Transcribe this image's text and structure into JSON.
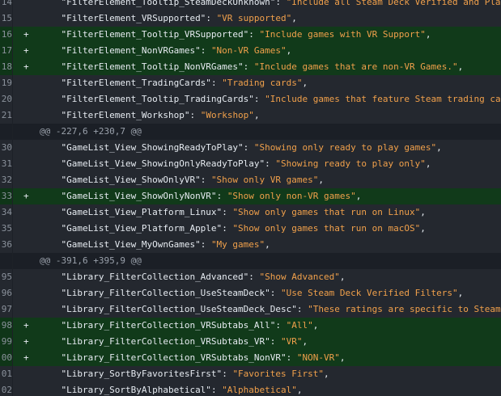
{
  "colors": {
    "background": "#24282f",
    "added_background": "#113a1a",
    "hunk_background": "#1b1f26",
    "key_text": "#e6ebf1",
    "string_value": "#f0a04b",
    "line_number": "#8b929c"
  },
  "lines": [
    {
      "type": "context",
      "num": "14",
      "key": "\"FilterElement_Tooltip_SteamDeckUnknown\"",
      "value": "\"Include all Steam Deck Verified and Playable games\""
    },
    {
      "type": "context",
      "num": "15",
      "key": "\"FilterElement_VRSupported\"",
      "value": "\"VR supported\""
    },
    {
      "type": "add",
      "num": "16",
      "key": "\"FilterElement_Tooltip_VRSupported\"",
      "value": "\"Include games with VR Support\""
    },
    {
      "type": "add",
      "num": "17",
      "key": "\"FilterElement_NonVRGames\"",
      "value": "\"Non-VR Games\""
    },
    {
      "type": "add",
      "num": "18",
      "key": "\"FilterElement_Tooltip_NonVRGames\"",
      "value": "\"Include games that are non-VR Games.\""
    },
    {
      "type": "context",
      "num": "19",
      "key": "\"FilterElement_TradingCards\"",
      "value": "\"Trading cards\""
    },
    {
      "type": "context",
      "num": "20",
      "key": "\"FilterElement_Tooltip_TradingCards\"",
      "value": "\"Include games that feature Steam trading cards\""
    },
    {
      "type": "context",
      "num": "21",
      "key": "\"FilterElement_Workshop\"",
      "value": "\"Workshop\""
    },
    {
      "type": "hunk",
      "num": "",
      "text": "@@ -227,6 +230,7 @@"
    },
    {
      "type": "context",
      "num": "30",
      "key": "\"GameList_View_ShowingReadyToPlay\"",
      "value": "\"Showing only ready to play games\""
    },
    {
      "type": "context",
      "num": "31",
      "key": "\"GameList_View_ShowingOnlyReadyToPlay\"",
      "value": "\"Showing ready to play only\""
    },
    {
      "type": "context",
      "num": "32",
      "key": "\"GameList_View_ShowOnlyVR\"",
      "value": "\"Show only VR games\""
    },
    {
      "type": "add",
      "num": "33",
      "key": "\"GameList_View_ShowOnlyNonVR\"",
      "value": "\"Show only non-VR games\""
    },
    {
      "type": "context",
      "num": "34",
      "key": "\"GameList_View_Platform_Linux\"",
      "value": "\"Show only games that run on Linux\""
    },
    {
      "type": "context",
      "num": "35",
      "key": "\"GameList_View_Platform_Apple\"",
      "value": "\"Show only games that run on macOS\""
    },
    {
      "type": "context",
      "num": "36",
      "key": "\"GameList_View_MyOwnGames\"",
      "value": "\"My games\""
    },
    {
      "type": "hunk",
      "num": "",
      "text": "@@ -391,6 +395,9 @@"
    },
    {
      "type": "context",
      "num": "95",
      "key": "\"Library_FilterCollection_Advanced\"",
      "value": "\"Show Advanced\""
    },
    {
      "type": "context",
      "num": "96",
      "key": "\"Library_FilterCollection_UseSteamDeck\"",
      "value": "\"Use Steam Deck Verified Filters\""
    },
    {
      "type": "context",
      "num": "97",
      "key": "\"Library_FilterCollection_UseSteamDeck_Desc\"",
      "value": "\"These ratings are specific to Steam Deck\""
    },
    {
      "type": "add",
      "num": "98",
      "key": "\"Library_FilterCollection_VRSubtabs_All\"",
      "value": "\"All\""
    },
    {
      "type": "add",
      "num": "99",
      "key": "\"Library_FilterCollection_VRSubtabs_VR\"",
      "value": "\"VR\""
    },
    {
      "type": "add",
      "num": "00",
      "key": "\"Library_FilterCollection_VRSubtabs_NonVR\"",
      "value": "\"NON-VR\""
    },
    {
      "type": "context",
      "num": "01",
      "key": "\"Library_SortByFavoritesFirst\"",
      "value": "\"Favorites First\""
    },
    {
      "type": "context",
      "num": "02",
      "key": "\"Library_SortByAlphabetical\"",
      "value": "\"Alphabetical\""
    }
  ]
}
